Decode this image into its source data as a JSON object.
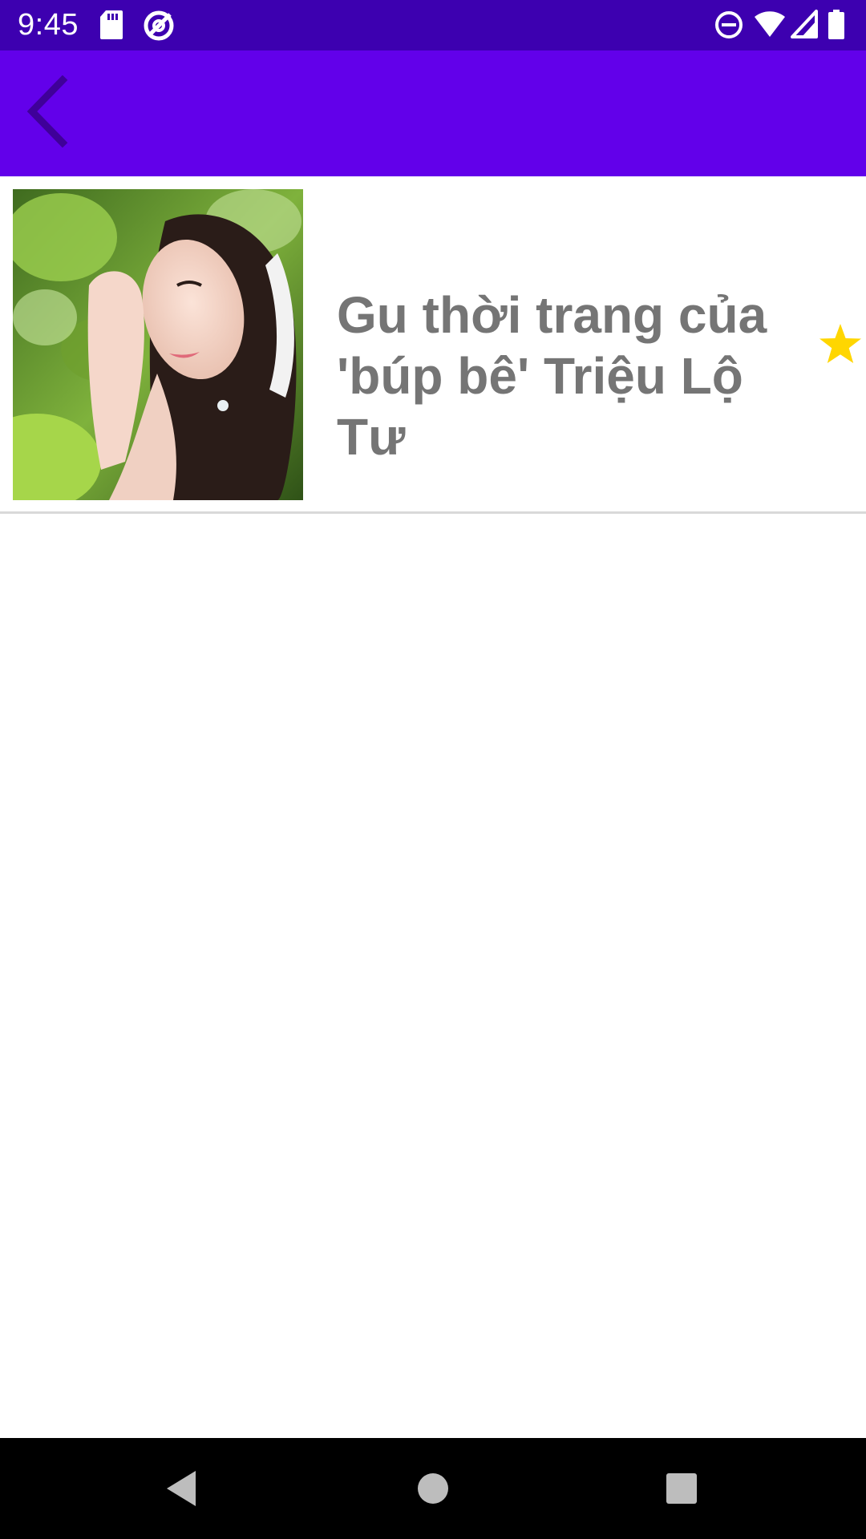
{
  "status_bar": {
    "time": "9:45",
    "left_icons": [
      "sd-card-icon",
      "sync-disabled-icon"
    ],
    "right_icons": [
      "do-not-disturb-icon",
      "wifi-icon",
      "signal-icon",
      "battery-icon"
    ],
    "background": "#3d00b0"
  },
  "app_bar": {
    "background": "#6200ea",
    "back_icon": "chevron-left-icon",
    "back_icon_color": "#3f0099"
  },
  "articles": [
    {
      "title": "Gu thời trang của 'búp bê' Triệu Lộ Tư",
      "thumbnail": "woman-portrait-photo",
      "favorite": true,
      "favorite_icon": "star-icon",
      "favorite_color": "#ffd600"
    }
  ],
  "nav_bar": {
    "buttons": [
      "back-triangle-icon",
      "home-circle-icon",
      "recents-square-icon"
    ]
  }
}
